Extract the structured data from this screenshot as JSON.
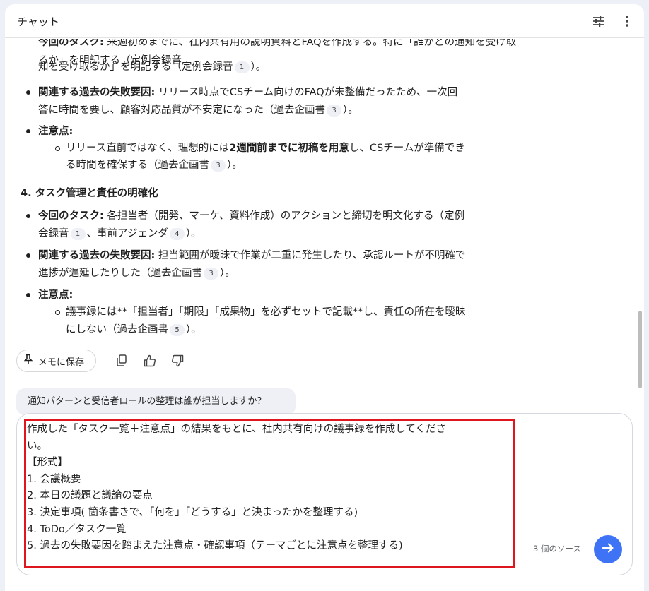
{
  "header": {
    "title": "チャット",
    "tune_icon": "tune-icon",
    "menu_icon": "more-vert-icon"
  },
  "answer": {
    "partial_top_b": "今回のタスク:",
    "partial_top": " 来週初めまでに、社内共有用の説明資料とFAQを作成する。特に「誰がどの通知を受け取るか」を明記する（定例会録音",
    "partial_top_line2": "知を受け取るか」を明記する（定例会録音",
    "cite_1": "1",
    "close": "）。",
    "s3_b2_label": "関連する過去の失敗要因:",
    "s3_b2_text": " リリース時点でCSチーム向けのFAQが未整備だったため、一次回",
    "s3_b2_text2": "答に時間を要し、顧客対応品質が不安定になった（過去企画書",
    "cite_3": "3",
    "s3_b3_label": "注意点:",
    "s3_sub_a": "リリース直前ではなく、理想的には",
    "s3_sub_b": "2週間前までに初稿を用意",
    "s3_sub_c": "し、CSチームが準備でき",
    "s3_sub_line2": "る時間を確保する（過去企画書",
    "section4": "4. タスク管理と責任の明確化",
    "s4_b1_label": "今回のタスク:",
    "s4_b1_text": " 各担当者（開発、マーケ、資料作成）のアクションと締切を明文化する（定例",
    "s4_b1_line2a": "会録音",
    "s4_b1_line2b": "、事前アジェンダ",
    "cite_4": "4",
    "s4_b2_label": "関連する過去の失敗要因:",
    "s4_b2_text": " 担当範囲が曖昧で作業が二重に発生したり、承認ルートが不明確で",
    "s4_b2_line2": "進捗が遅延したりした（過去企画書",
    "s4_b3_label": "注意点:",
    "s4_sub_line1": "議事録には**「担当者」「期限」「成果物」を必ずセットで記載**し、責任の所在を曖昧",
    "s4_sub_line2": "にしない（過去企画書",
    "cite_5": "5"
  },
  "actions": {
    "memo_save": "メモに保存",
    "copy_icon": "copy-icon",
    "thumbs_up_icon": "thumbs-up-icon",
    "thumbs_down_icon": "thumbs-down-icon"
  },
  "suggestion": "通知パターンと受信者ロールの整理は誰が担当しますか？",
  "input": {
    "value": "作成した「タスク一覧＋注意点」の結果をもとに、社内共有向けの議事録を作成してくださ\nい。\n【形式】\n1. 会議概要\n2. 本日の議題と議論の要点\n3. 決定事項( 箇条書きで、「何を」「どうする」と決まったかを整理する)\n4. ToDo／タスク一覧\n5. 過去の失敗要因を踏まえた注意点・確認事項（テーマごとに注意点を整理する)",
    "source_count": "3 個のソース",
    "send_icon": "arrow-right-icon"
  },
  "colors": {
    "accent": "#3f73f5",
    "highlight_frame": "#e0161f"
  }
}
